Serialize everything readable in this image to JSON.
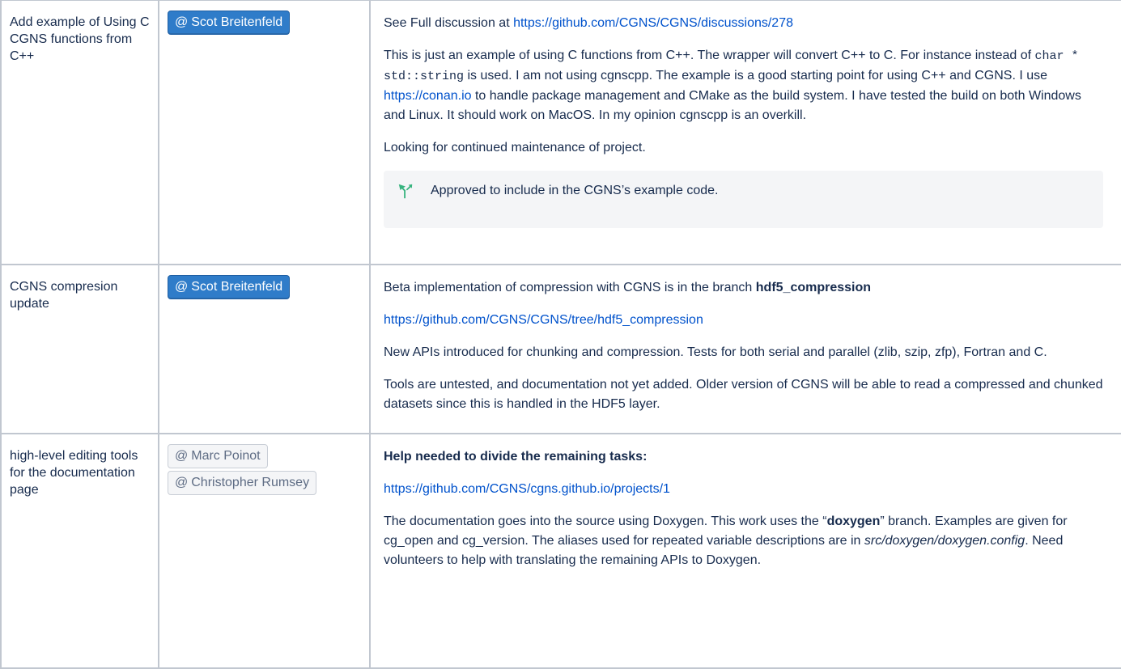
{
  "rows": [
    {
      "topic": "Add example of Using C CGNS functions from C++",
      "owners": [
        "Scot Breitenfeld"
      ],
      "discussion_prefix": "See Full discussion at ",
      "discussion_link": "https://github.com/CGNS/CGNS/discussions/278",
      "para1_a": "This is just an example of using C functions from C++. The wrapper will convert C++ to C. For instance instead of ",
      "para1_code": "char * std::string",
      "para1_b": " is used. I am not using cgnscpp. The example is a good starting point for using C++ and CGNS. I use ",
      "para1_link": "https://conan.io",
      "para1_c": " to handle package management and CMake as the build system. I have tested the build on both Windows and Linux. It should work on MacOS. In my opinion cgnscpp is an overkill.",
      "para2": "Looking for continued maintenance of project.",
      "panel_text": "Approved to include in the CGNS’s example code."
    },
    {
      "topic": "CGNS compresion update",
      "owners": [
        "Scot Breitenfeld"
      ],
      "para1_a": "Beta implementation of compression with CGNS is in the branch ",
      "para1_bold": "hdf5_compression",
      "link": "https://github.com/CGNS/CGNS/tree/hdf5_compression",
      "para2": "New APIs introduced for chunking and compression. Tests for both serial and parallel (zlib, szip, zfp), Fortran and C.",
      "para3": "Tools are untested, and documentation not yet added. Older version of CGNS will be able to read a compressed and chunked datasets since this is handled in the HDF5 layer."
    },
    {
      "topic": "high-level editing tools for the documentation page",
      "owners": [
        "Marc Poinot",
        "Christopher Rumsey"
      ],
      "heading": "Help needed to divide the remaining tasks:",
      "link": "https://github.com/CGNS/cgns.github.io/projects/1",
      "para_a": "The documentation goes into the source using Doxygen. This work uses the “",
      "para_bold": "doxygen",
      "para_b": "” branch. Examples are given for cg_open and cg_version. The aliases used for repeated variable descriptions are in ",
      "para_ital": "src/doxygen/doxygen.config",
      "para_c": ". Need volunteers to help with translating the remaining APIs to Doxygen."
    }
  ],
  "mention_symbol": "@",
  "colors": {
    "mention_bg": "#2f7cc9",
    "link": "#0052cc",
    "panel_bg": "#f4f5f7",
    "icon": "#36b37e"
  }
}
